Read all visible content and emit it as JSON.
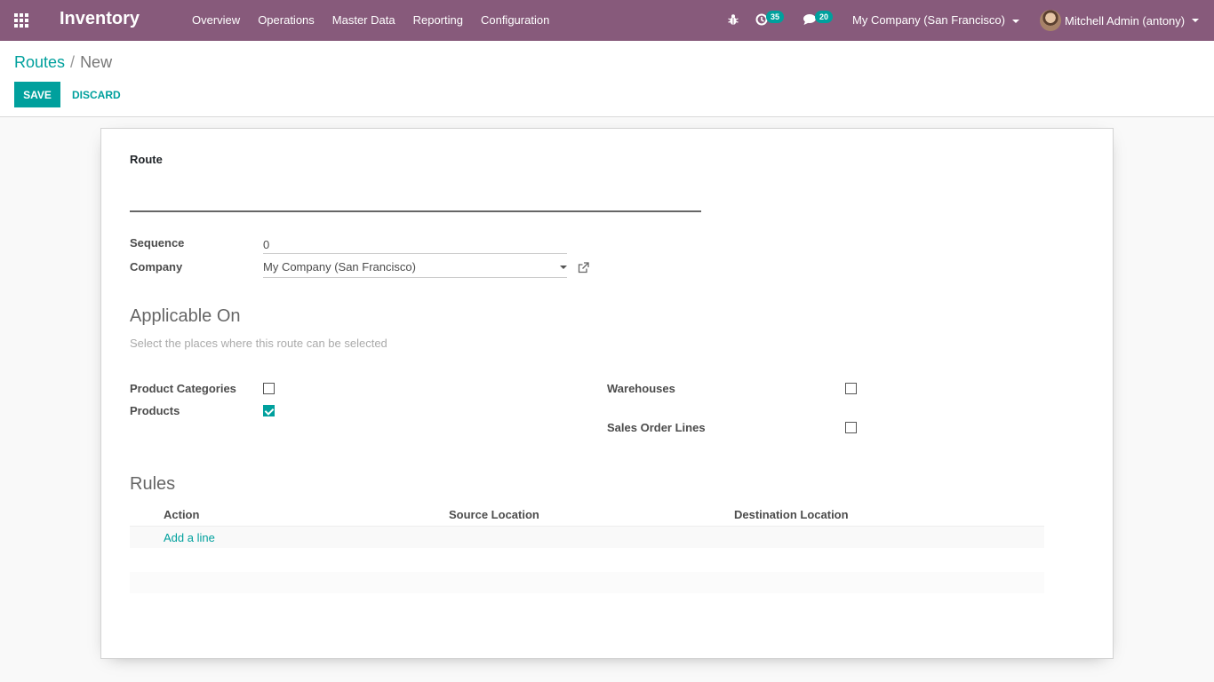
{
  "navbar": {
    "app_title": "Inventory",
    "menu": [
      "Overview",
      "Operations",
      "Master Data",
      "Reporting",
      "Configuration"
    ],
    "activity_count": "35",
    "message_count": "20",
    "company": "My Company (San Francisco)",
    "user": "Mitchell Admin (antony)",
    "icons": [
      "apps-grid-icon",
      "bug-icon",
      "clock-icon",
      "chat-icon",
      "avatar"
    ],
    "color": "#875a7b"
  },
  "breadcrumb": {
    "parent": "Routes",
    "separator": "/",
    "current": "New"
  },
  "buttons": {
    "save": "SAVE",
    "discard": "DISCARD"
  },
  "form": {
    "route_label": "Route",
    "route_value": "",
    "sequence_label": "Sequence",
    "sequence_value": "0",
    "company_label": "Company",
    "company_value": "My Company (San Francisco)",
    "applicable_title": "Applicable On",
    "applicable_help": "Select the places where this route can be selected",
    "checkboxes": {
      "product_categories": {
        "label": "Product Categories",
        "checked": false
      },
      "products": {
        "label": "Products",
        "checked": true
      },
      "warehouses": {
        "label": "Warehouses",
        "checked": false
      },
      "sales_order_lines": {
        "label": "Sales Order Lines",
        "checked": false
      }
    },
    "rules_title": "Rules",
    "rules_columns": [
      "Action",
      "Source Location",
      "Destination Location"
    ],
    "add_line": "Add a line"
  },
  "colors": {
    "accent": "#00a09d",
    "brand": "#875a7b"
  }
}
